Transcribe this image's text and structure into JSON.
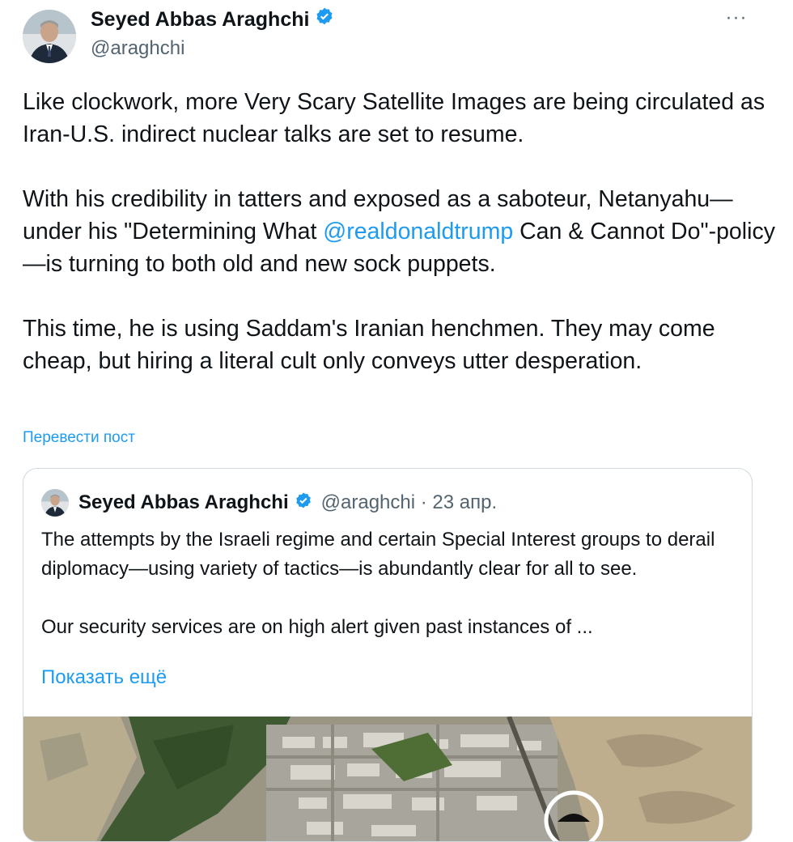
{
  "author": {
    "name": "Seyed Abbas Araghchi",
    "handle": "@araghchi",
    "verified": true
  },
  "more_button": {
    "icon": "more-horizontal-icon",
    "label": "···"
  },
  "tweet": {
    "p1": "Like clockwork, more Very Scary Satellite Images are being circulated as Iran-U.S. indirect nuclear talks are set to resume.",
    "p2_before": "With his credibility in tatters and exposed as a saboteur, Netanyahu—under his \"Determining What ",
    "p2_mention": "@realdonaldtrump",
    "p2_after": " Can & Cannot Do\"-policy—is turning to both old and new sock puppets.",
    "p3": "This time, he is using Saddam's Iranian henchmen. They may come cheap, but hiring a literal cult only conveys utter desperation."
  },
  "translate_label": "Перевести пост",
  "quote": {
    "name": "Seyed Abbas Araghchi",
    "handle": "@araghchi",
    "separator": "·",
    "date": "23 апр.",
    "p1": "The attempts by the Israeli regime and certain Special Interest groups to derail diplomacy—using variety of tactics—is abundantly clear for all to see.",
    "p2": "Our security services are on high alert given past instances of ...",
    "show_more": "Показать ещё"
  },
  "colors": {
    "accent": "#1d9bf0",
    "text": "#0f1419",
    "secondary": "#536471",
    "border": "#cfd9de"
  }
}
